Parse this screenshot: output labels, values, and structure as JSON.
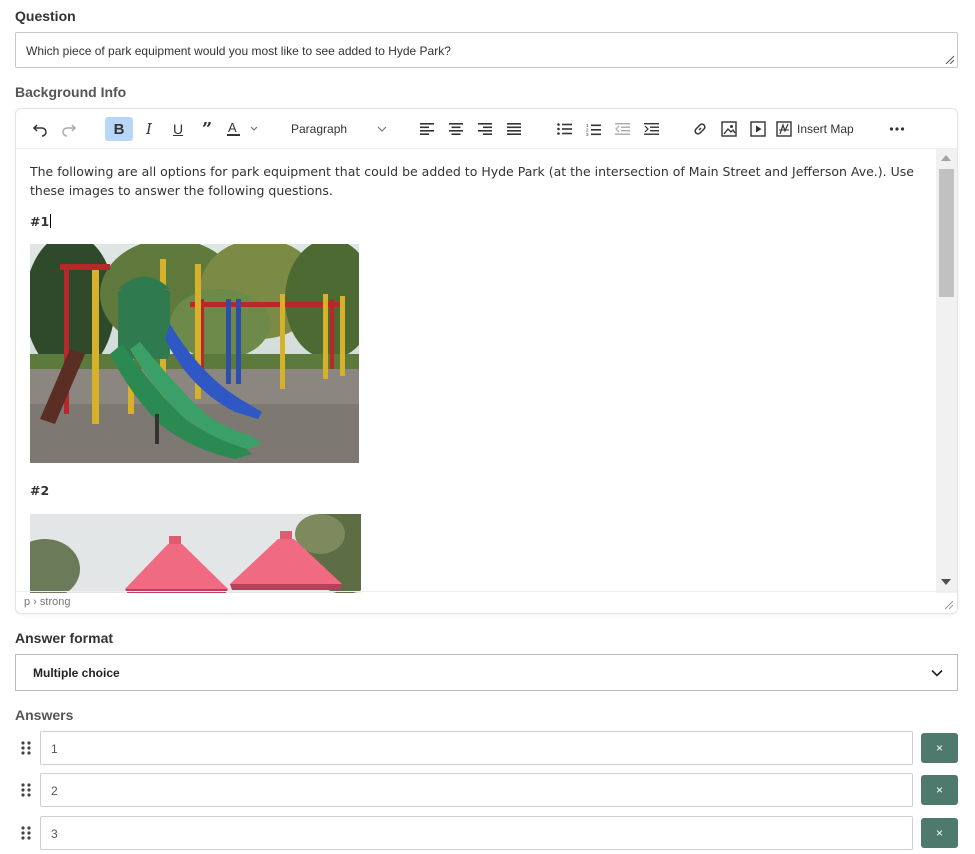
{
  "question": {
    "label": "Question",
    "value": "Which piece of park equipment would you most like to see added to Hyde Park?"
  },
  "background": {
    "label": "Background Info",
    "toolbar": {
      "block_format": "Paragraph",
      "insert_map_label": "Insert Map",
      "icons": [
        "undo-icon",
        "redo-icon",
        "bold-icon",
        "italic-icon",
        "underline-icon",
        "blockquote-icon",
        "text-color-icon",
        "align-left-icon",
        "align-center-icon",
        "align-right-icon",
        "align-justify-icon",
        "bullet-list-icon",
        "numbered-list-icon",
        "outdent-icon",
        "indent-icon",
        "link-icon",
        "image-icon",
        "media-icon",
        "map-icon",
        "more-icon"
      ]
    },
    "content": {
      "intro": "The following are all options for park equipment that could be added to Hyde Park (at the intersection of Main Street and Jefferson Ave.). Use these images to answer the following questions.",
      "heading1": "#1",
      "heading2": "#2"
    },
    "statusbar": "p › strong"
  },
  "answer_format": {
    "label": "Answer format",
    "selected": "Multiple choice"
  },
  "answers": {
    "label": "Answers",
    "items": [
      "1",
      "2",
      "3"
    ],
    "remove_label": "×"
  },
  "colors": {
    "active_button": "#b8d6f8",
    "remove_button": "#4e7a6e"
  }
}
